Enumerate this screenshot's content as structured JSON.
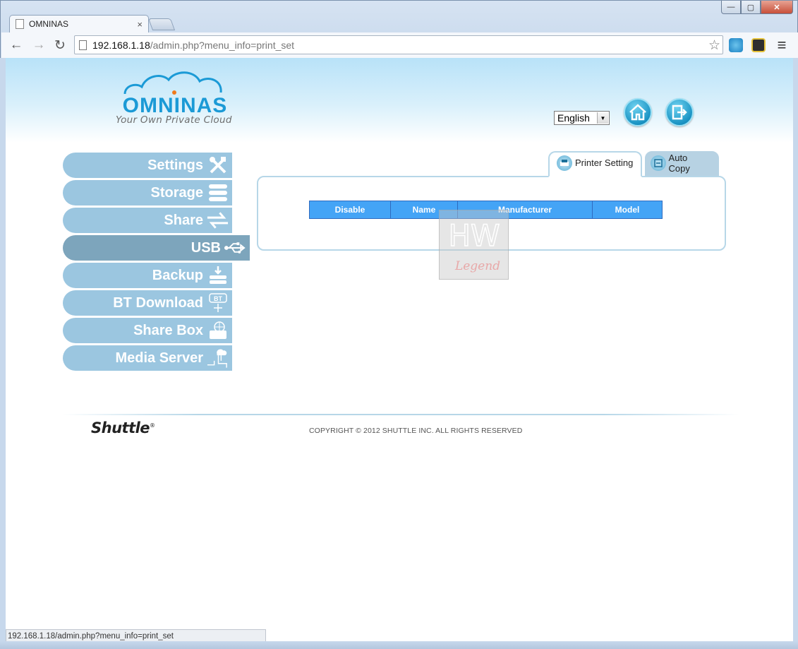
{
  "browser": {
    "tab_title": "OMNINAS",
    "tab_close": "×",
    "url_host": "192.168.1.18",
    "url_path": "/admin.php?menu_info=print_set",
    "status_url": "192.168.1.18/admin.php?menu_info=print_set",
    "window_buttons": {
      "minimize": "—",
      "maximize": "▢",
      "close": "✕"
    },
    "nav": {
      "back": "←",
      "forward": "→",
      "reload": "↻",
      "menu": "≡",
      "star": "☆"
    }
  },
  "header": {
    "logo_text": "OMNINAS",
    "logo_tagline": "Your Own Private Cloud",
    "language": "English"
  },
  "sidebar": {
    "items": [
      {
        "label": "Settings",
        "icon": "tools-icon"
      },
      {
        "label": "Storage",
        "icon": "storage-icon"
      },
      {
        "label": "Share",
        "icon": "share-arrows-icon"
      },
      {
        "label": "USB",
        "icon": "usb-icon",
        "active": true
      },
      {
        "label": "Backup",
        "icon": "backup-icon"
      },
      {
        "label": "BT Download",
        "icon": "bt-icon"
      },
      {
        "label": "Share Box",
        "icon": "sharebox-icon"
      },
      {
        "label": "Media Server",
        "icon": "media-server-icon"
      }
    ]
  },
  "tabs": [
    {
      "label": "Printer Setting",
      "active": true
    },
    {
      "label": "Auto Copy",
      "active": false
    }
  ],
  "printer_table": {
    "columns": [
      "Disable",
      "Name",
      "Manufacturer",
      "Model"
    ]
  },
  "watermark": {
    "top": "HW",
    "bottom": "Legend"
  },
  "footer": {
    "brand": "Shuttle",
    "brand_mark": "®",
    "copyright": "COPYRIGHT © 2012 SHUTTLE INC. ALL RIGHTS RESERVED"
  },
  "colors": {
    "sidebar": "#9bc6e0",
    "sidebar_active": "#7da5bc",
    "table_header": "#44a4f6",
    "logo": "#1b9ad6"
  }
}
